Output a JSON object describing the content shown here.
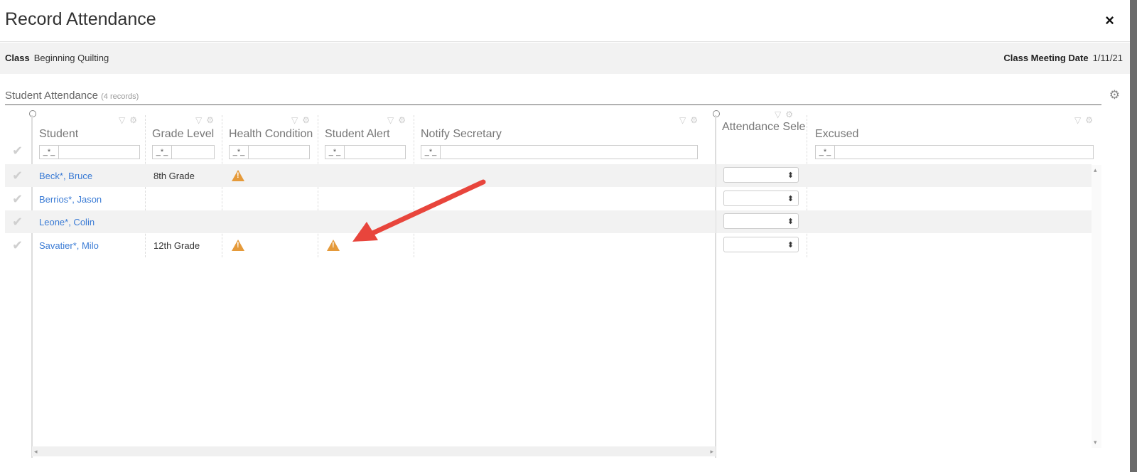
{
  "header": {
    "title": "Record Attendance",
    "close_icon": "×"
  },
  "info": {
    "class_label": "Class",
    "class_value": "Beginning Quilting",
    "date_label": "Class Meeting Date",
    "date_value": "1/11/21"
  },
  "section": {
    "title": "Student Attendance",
    "count": "(4 records)"
  },
  "columns": {
    "student": "Student",
    "grade": "Grade Level",
    "health": "Health Condition",
    "alert": "Student Alert",
    "notify": "Notify Secretary",
    "attendance": "Attendance Sele",
    "excused": "Excused",
    "filter_op": "_*_"
  },
  "rows": [
    {
      "name": "Beck*, Bruce",
      "grade": "8th Grade",
      "health_warn": true,
      "alert_warn": false
    },
    {
      "name": "Berrios*, Jason",
      "grade": "",
      "health_warn": false,
      "alert_warn": false
    },
    {
      "name": "Leone*, Colin",
      "grade": "",
      "health_warn": false,
      "alert_warn": false
    },
    {
      "name": "Savatier*, Milo",
      "grade": "12th Grade",
      "health_warn": true,
      "alert_warn": true
    }
  ],
  "icons": {
    "close": "close-icon",
    "gear": "gear-icon",
    "filter": "filter-icon",
    "check": "checkmark-icon",
    "warning": "warning-icon",
    "arrow": "annotation-arrow"
  },
  "colors": {
    "link": "#3a7bd5",
    "warning": "#e59a3a",
    "arrow": "#e8453c",
    "infobar": "#f2f2f2"
  }
}
